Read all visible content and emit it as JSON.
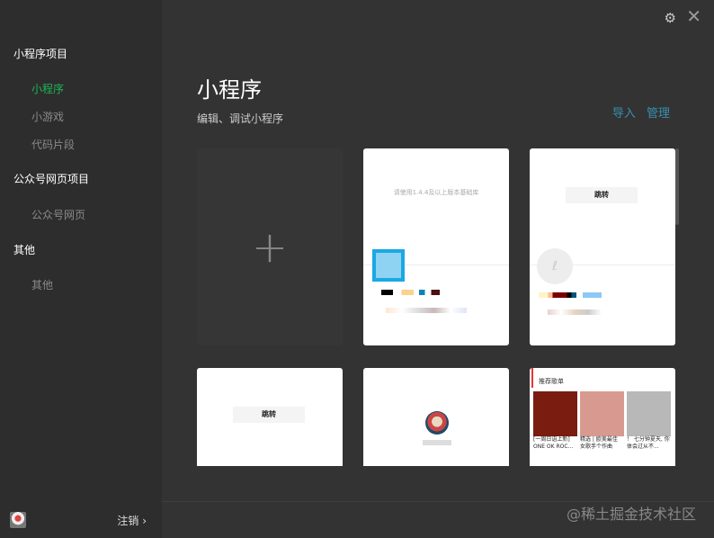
{
  "sidebar": {
    "sections": [
      {
        "title": "小程序项目",
        "items": [
          "小程序",
          "小游戏",
          "代码片段"
        ]
      },
      {
        "title": "公众号网页项目",
        "items": [
          "公众号网页"
        ]
      },
      {
        "title": "其他",
        "items": [
          "其他"
        ]
      }
    ],
    "active_item": "小程序",
    "logout_label": "注销 ›"
  },
  "main": {
    "title": "小程序",
    "subtitle": "编辑、调试小程序",
    "import_label": "导入",
    "manage_label": "管理",
    "cards": {
      "hint": "请使用1.4.4及以上版本基础库",
      "jump_label": "跳转",
      "playlist_title": "推荐歌单",
      "playlist_captions": [
        "[一周日语上新] ONE OK ROC...",
        "精选 | 欧美最佳 女歌手个作曲",
        "！ 七分钟夏天, 你体会过从不..."
      ]
    }
  },
  "watermark": "@稀土掘金技术社区",
  "colors": {
    "accent": "#1fb458",
    "link": "#3a8fb0"
  }
}
